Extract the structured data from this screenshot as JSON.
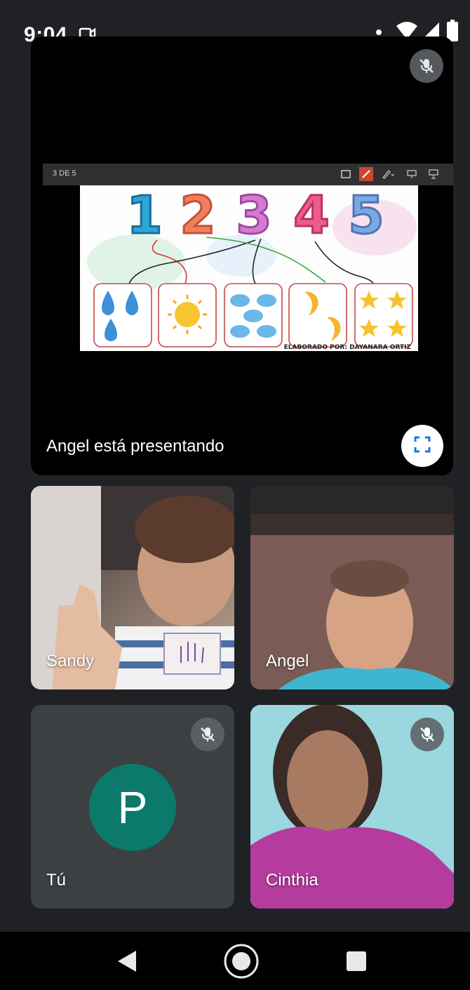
{
  "status_bar": {
    "time": "9:04"
  },
  "presentation": {
    "slide_counter": "3 DE 5",
    "presenter_label": "Angel está presentando",
    "slide": {
      "numbers": [
        "1",
        "2",
        "3",
        "4",
        "5"
      ],
      "credit": "ELABORADO POR: DAYANARA ORTIZ"
    }
  },
  "participants": {
    "sandy": {
      "name": "Sandy"
    },
    "angel": {
      "name": "Angel"
    },
    "tu": {
      "name": "Tú",
      "initial": "P"
    },
    "cinthia": {
      "name": "Cinthia"
    }
  },
  "colors": {
    "background": "#202124",
    "tile": "#3c4043",
    "avatar": "#0b7a6a",
    "accent": "#1a73e8"
  },
  "icons": {
    "status": [
      "camera-icon",
      "wifi-icon",
      "signal-icon",
      "battery-icon"
    ],
    "presentation": [
      "mic-off-icon",
      "fullscreen-icon"
    ],
    "navigation": [
      "back-icon",
      "home-icon",
      "recents-icon"
    ]
  }
}
